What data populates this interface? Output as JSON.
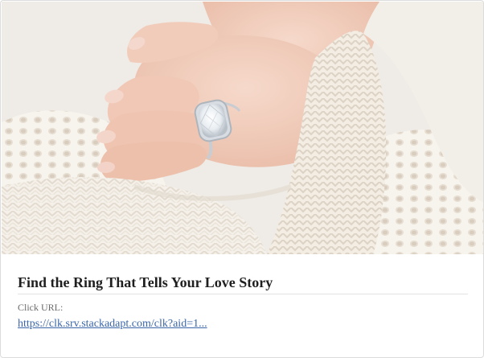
{
  "ad": {
    "image_alt": "Woman's hand wearing an oval diamond solitaire engagement ring, resting on a cream knit sweater",
    "headline": "Find the Ring That Tells Your Love Story",
    "click_url_label": "Click URL:",
    "click_url": "https://clk.srv.stackadapt.com/clk?aid=1..."
  },
  "colors": {
    "headline": "#1f1f1f",
    "label": "#6b6b6b",
    "link": "#3a66a8",
    "knit": "#f4efe7",
    "skin": "#f1cdbd"
  }
}
